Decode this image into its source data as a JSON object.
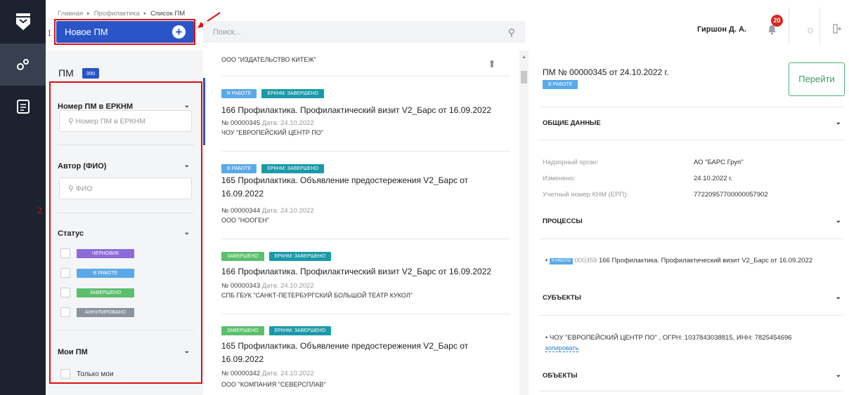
{
  "header": {
    "breadcrumb": [
      "Главная",
      "Профилактика",
      "Список ПМ"
    ],
    "new_button": "Новое ПМ",
    "search_placeholder": "Поиск...",
    "user_name": "Гиршон Д. А.",
    "notification_count": "20",
    "annotation_1": "1",
    "annotation_2": "2"
  },
  "filters": {
    "title": "ПМ",
    "count": "390",
    "erknm_label": "Номер ПМ в ЕРКНМ",
    "erknm_placeholder": "Номер ПМ в ЕРКНМ",
    "author_label": "Автор (ФИО)",
    "author_placeholder": "ФИО",
    "status_label": "Статус",
    "statuses": [
      {
        "label": "ЧЕРНОВИК",
        "color": "#8e6bd6"
      },
      {
        "label": "В РАБОТЕ",
        "color": "#5aa9e8"
      },
      {
        "label": "ЗАВЕРШЕНО",
        "color": "#5cbf6d"
      },
      {
        "label": "АННУЛИРОВАНО",
        "color": "#8a93a0"
      }
    ],
    "mine_label": "Мои ПМ",
    "only_mine": "Только мои"
  },
  "list": {
    "top_org": "ООО \"ИЗДАТЕЛЬСТВО КИТЕЖ\"",
    "date_label": "Дата:",
    "items": [
      {
        "tag1": "В РАБОТЕ",
        "tag2": "ЕРКНМ: ЗАВЕРШЕНО",
        "title": "166 Профилактика. Профилактический визит V2_Барс от 16.09.2022",
        "number": "№ 00000345",
        "date": "24.10.2022",
        "org": "ЧОУ \"ЕВРОПЕЙСКИЙ ЦЕНТР ПО\""
      },
      {
        "tag1": "В РАБОТЕ",
        "tag2": "ЕРКНМ: ЗАВЕРШЕНО",
        "title": "165 Профилактика. Объявление предостережения V2_Барс от 16.09.2022",
        "number": "№ 00000344",
        "date": "24.10.2022",
        "org": "ООО \"НООГЕН\""
      },
      {
        "tag1": "ЗАВЕРШЕНО",
        "tag2": "ЕРКНМ: ЗАВЕРШЕНО",
        "title": "166 Профилактика. Профилактический визит V2_Барс от 16.09.2022",
        "number": "№ 00000343",
        "date": "24.10.2022",
        "org": "СПБ ГБУК \"САНКТ-ПЕТЕРБУРГСКИЙ БОЛЬШОЙ ТЕАТР КУКОЛ\""
      },
      {
        "tag1": "ЗАВЕРШЕНО",
        "tag2": "ЕРКНМ: ЗАВЕРШЕНО",
        "title": "165 Профилактика. Объявление предостережения V2_Барс от 16.09.2022",
        "number": "№ 00000342",
        "date": "24.10.2022",
        "org": "ООО \"КОМПАНИЯ \"СЕВЕРСПЛАВ\""
      }
    ]
  },
  "detail": {
    "title": "ПМ № 00000345 от 24.10.2022 г.",
    "status": "В РАБОТЕ",
    "goto": "Перейти",
    "general": "ОБЩИЕ ДАННЫЕ",
    "rows": [
      {
        "key": "Надзорный орган:",
        "value": "АО \"БАРС Груп\""
      },
      {
        "key": "Изменено:",
        "value": "24.10.2022 г."
      },
      {
        "key": "Учетный номер КНМ (ЕРП):",
        "value": "77220957700000057902"
      }
    ],
    "processes": "ПРОЦЕССЫ",
    "process_tag": "В РАБОТЕ",
    "process_num": "000359",
    "process_text": "166 Профилактика. Профилактический визит V2_Барс от 16.09.2022",
    "subjects": "СУБЪЕКТЫ",
    "subject_text": "ЧОУ \"ЕВРОПЕЙСКИЙ ЦЕНТР ПО\" , ОГРН: 1037843038815, ИНН: 7825454696",
    "copy": "копировать",
    "objects": "ОБЪЕКТЫ"
  }
}
